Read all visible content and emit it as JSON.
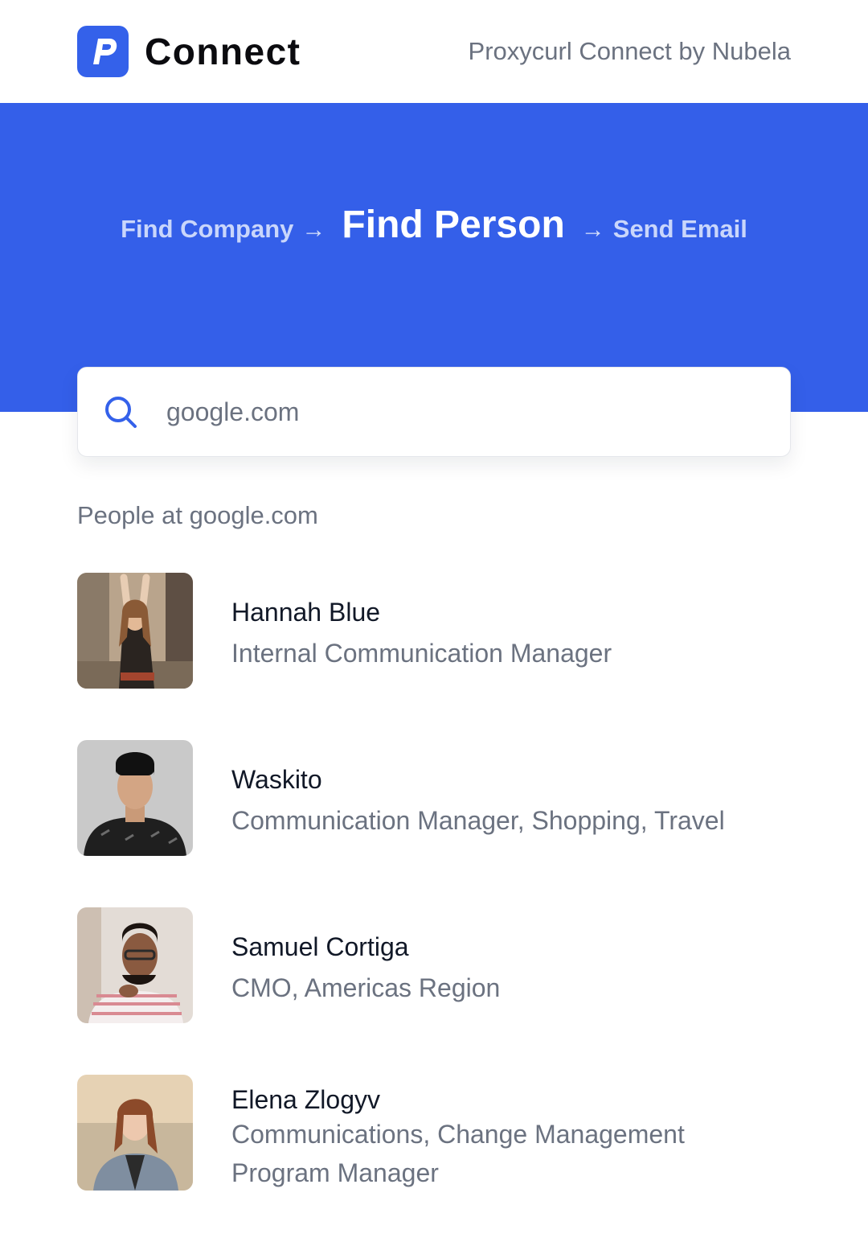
{
  "header": {
    "brand": "Connect",
    "byline": "Proxycurl Connect by Nubela",
    "logo_icon": "proxycurl-p-logo",
    "brand_color": "#3461EA"
  },
  "hero": {
    "background": "#345FE9",
    "steps": [
      {
        "label": "Find Company",
        "active": false
      },
      {
        "label": "Find Person",
        "active": true
      },
      {
        "label": "Send Email",
        "active": false
      }
    ]
  },
  "search": {
    "icon": "search-icon",
    "value": "google.com",
    "placeholder": "google.com"
  },
  "people_section": {
    "label": "People at google.com",
    "people": [
      {
        "name": "Hannah Blue",
        "title": "Internal Communication Manager"
      },
      {
        "name": "Waskito",
        "title": "Communication Manager, Shopping, Travel"
      },
      {
        "name": "Samuel Cortiga",
        "title": "CMO, Americas Region"
      },
      {
        "name": "Elena Zlogyv",
        "title": "Communications, Change Management Program Manager"
      }
    ]
  }
}
